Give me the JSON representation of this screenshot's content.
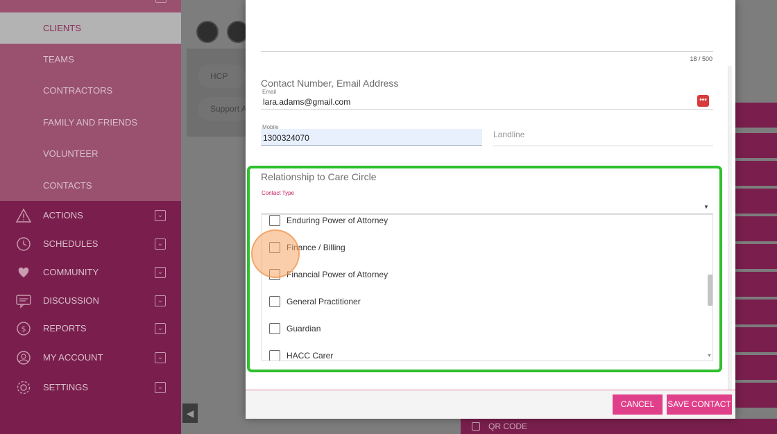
{
  "sidebar": {
    "subitems": [
      {
        "label": "CLIENTS",
        "active": true
      },
      {
        "label": "TEAMS"
      },
      {
        "label": "CONTRACTORS"
      },
      {
        "label": "FAMILY AND FRIENDS"
      },
      {
        "label": "VOLUNTEER"
      },
      {
        "label": "CONTACTS"
      }
    ],
    "items": [
      {
        "label": "ACTIONS",
        "icon": "warning-icon"
      },
      {
        "label": "SCHEDULES",
        "icon": "clock-icon"
      },
      {
        "label": "COMMUNITY",
        "icon": "heart-hands-icon"
      },
      {
        "label": "DISCUSSION",
        "icon": "chat-icon"
      },
      {
        "label": "REPORTS",
        "icon": "dollar-icon"
      },
      {
        "label": "MY ACCOUNT",
        "icon": "user-icon"
      },
      {
        "label": "SETTINGS",
        "icon": "gear-icon"
      }
    ]
  },
  "background": {
    "chips": [
      "HCP",
      "Support A"
    ],
    "qr_label": "QR CODE"
  },
  "modal": {
    "counter": "18 / 500",
    "contact_section_title": "Contact Number, Email Address",
    "email_label": "Email",
    "email_value": "lara.adams@gmail.com",
    "mobile_label": "Mobile",
    "mobile_value": "1300324070",
    "landline_placeholder": "Landline",
    "relationship_title": "Relationship to Care Circle",
    "contact_type_label": "Contact Type",
    "options": [
      "Enduring Power of Attorney",
      "Finance / Billing",
      "Financial Power of Attorney",
      "General Practitioner",
      "Guardian",
      "HACC Carer"
    ],
    "cancel_label": "CANCEL",
    "save_label": "SAVE CONTACT"
  },
  "colors": {
    "accent": "#e0408a",
    "sidebar": "#7a1f4d",
    "highlight": "#2ec02e",
    "label_pink": "#c2185b"
  }
}
